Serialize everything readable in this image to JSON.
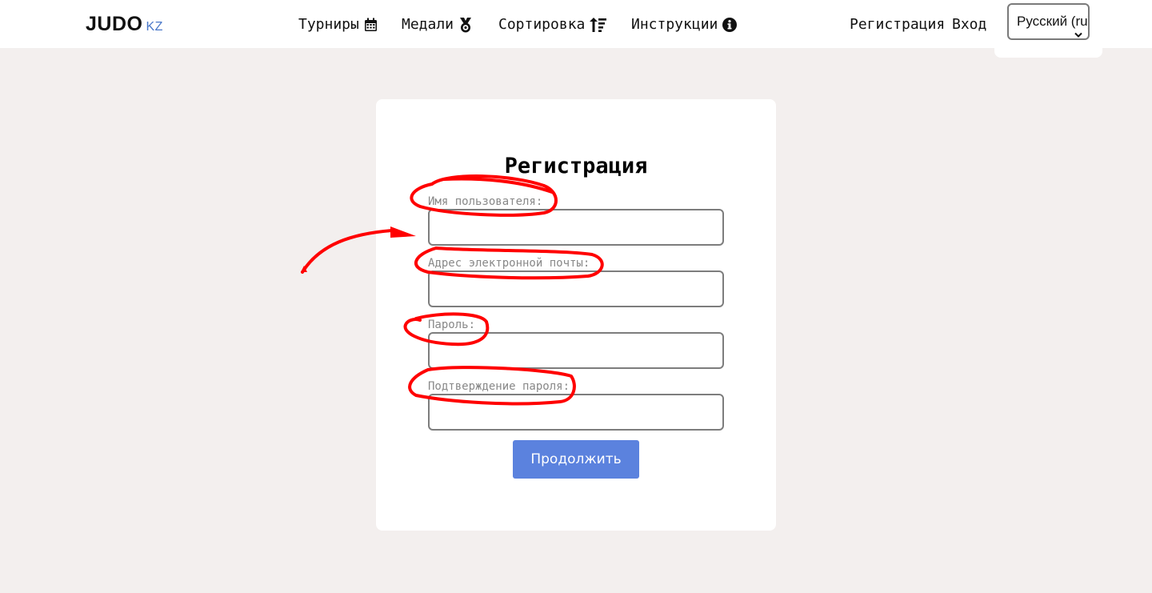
{
  "header": {
    "logo_main": "JUDO",
    "logo_suffix": "KZ",
    "nav": {
      "tournaments": "Турниры",
      "medals": "Медали",
      "sorting": "Сортировка",
      "instructions": "Инструкции"
    },
    "register": "Регистрация",
    "login": "Вход",
    "language": "Русский (ru)"
  },
  "form": {
    "title": "Регистрация",
    "username_label": "Имя пользователя:",
    "email_label": "Адрес электронной почты:",
    "password_label": "Пароль:",
    "confirm_label": "Подтверждение пароля:",
    "submit_label": "Продолжить"
  },
  "annotation_color": "#ff0000",
  "accent_color": "#5b82de",
  "icons": [
    "calendar-icon",
    "medal-icon",
    "sort-icon",
    "info-icon",
    "chevron-down-icon"
  ]
}
